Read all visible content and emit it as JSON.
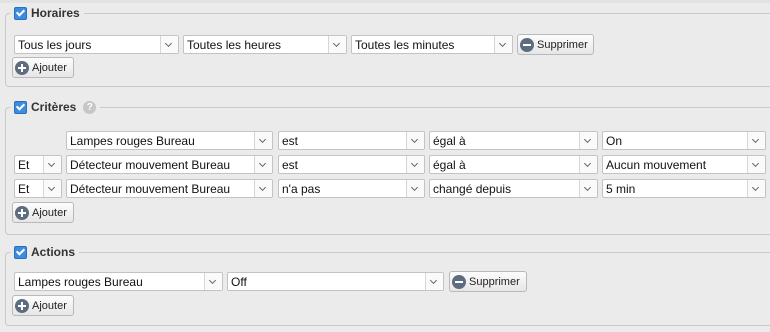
{
  "sections": {
    "horaires": {
      "title": "Horaires",
      "day": "Tous les jours",
      "hours": "Toutes les heures",
      "minutes": "Toutes les minutes",
      "remove_label": "Supprimer",
      "add_label": "Ajouter"
    },
    "criteres": {
      "title": "Critères",
      "help": "?",
      "rows": [
        {
          "conj": "",
          "device": "Lampes rouges Bureau",
          "verb": "est",
          "op": "égal à",
          "value": "On"
        },
        {
          "conj": "Et",
          "device": "Détecteur mouvement Bureau",
          "verb": "est",
          "op": "égal à",
          "value": "Aucun mouvement"
        },
        {
          "conj": "Et",
          "device": "Détecteur mouvement Bureau",
          "verb": "n'a pas",
          "op": "changé depuis",
          "value": "5 min"
        }
      ],
      "add_label": "Ajouter"
    },
    "actions": {
      "title": "Actions",
      "device": "Lampes rouges Bureau",
      "value": "Off",
      "remove_label": "Supprimer",
      "add_label": "Ajouter"
    }
  }
}
